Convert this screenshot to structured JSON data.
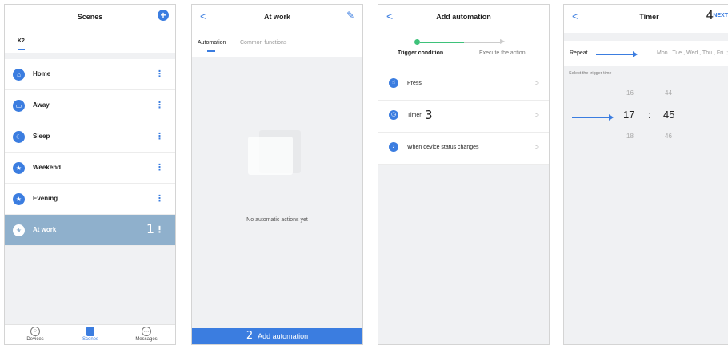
{
  "colors": {
    "accent": "#3b7de0",
    "selected_row": "#8fb0cc",
    "success": "#3ec27a",
    "pane_bg": "#f0f1f3"
  },
  "scenes_screen": {
    "title": "Scenes",
    "home_tab": "K2",
    "scenes": [
      {
        "label": "Home",
        "icon": "home-icon"
      },
      {
        "label": "Away",
        "icon": "briefcase-icon"
      },
      {
        "label": "Sleep",
        "icon": "moon-icon"
      },
      {
        "label": "Weekend",
        "icon": "star-icon"
      },
      {
        "label": "Evening",
        "icon": "star-icon"
      },
      {
        "label": "At work",
        "icon": "star-icon",
        "selected": true,
        "step": "1"
      }
    ],
    "tabbar": {
      "devices": "Devices",
      "scenes": "Scenes",
      "messages": "Messages"
    }
  },
  "at_work_screen": {
    "title": "At work",
    "tab_automation": "Automation",
    "tab_common": "Common functions",
    "empty_text": "No automatic actions yet",
    "add_button": "Add automation",
    "step": "2"
  },
  "add_automation_screen": {
    "title": "Add automation",
    "step_trigger": "Trigger condition",
    "step_action": "Execute the action",
    "options": [
      {
        "label": "Press",
        "icon": "hand-press-icon"
      },
      {
        "label": "Timer",
        "icon": "alarm-clock-icon",
        "step": "3"
      },
      {
        "label": "When device status changes",
        "icon": "bell-icon"
      }
    ]
  },
  "timer_screen": {
    "title": "Timer",
    "next": "NEXT",
    "step": "4",
    "repeat_label": "Repeat",
    "repeat_value": "Mon , Tue , Wed , Thu , Fri",
    "select_label": "Select the trigger time",
    "hours": [
      "16",
      "17",
      "18"
    ],
    "minutes": [
      "44",
      "45",
      "46"
    ],
    "separator": ":"
  }
}
